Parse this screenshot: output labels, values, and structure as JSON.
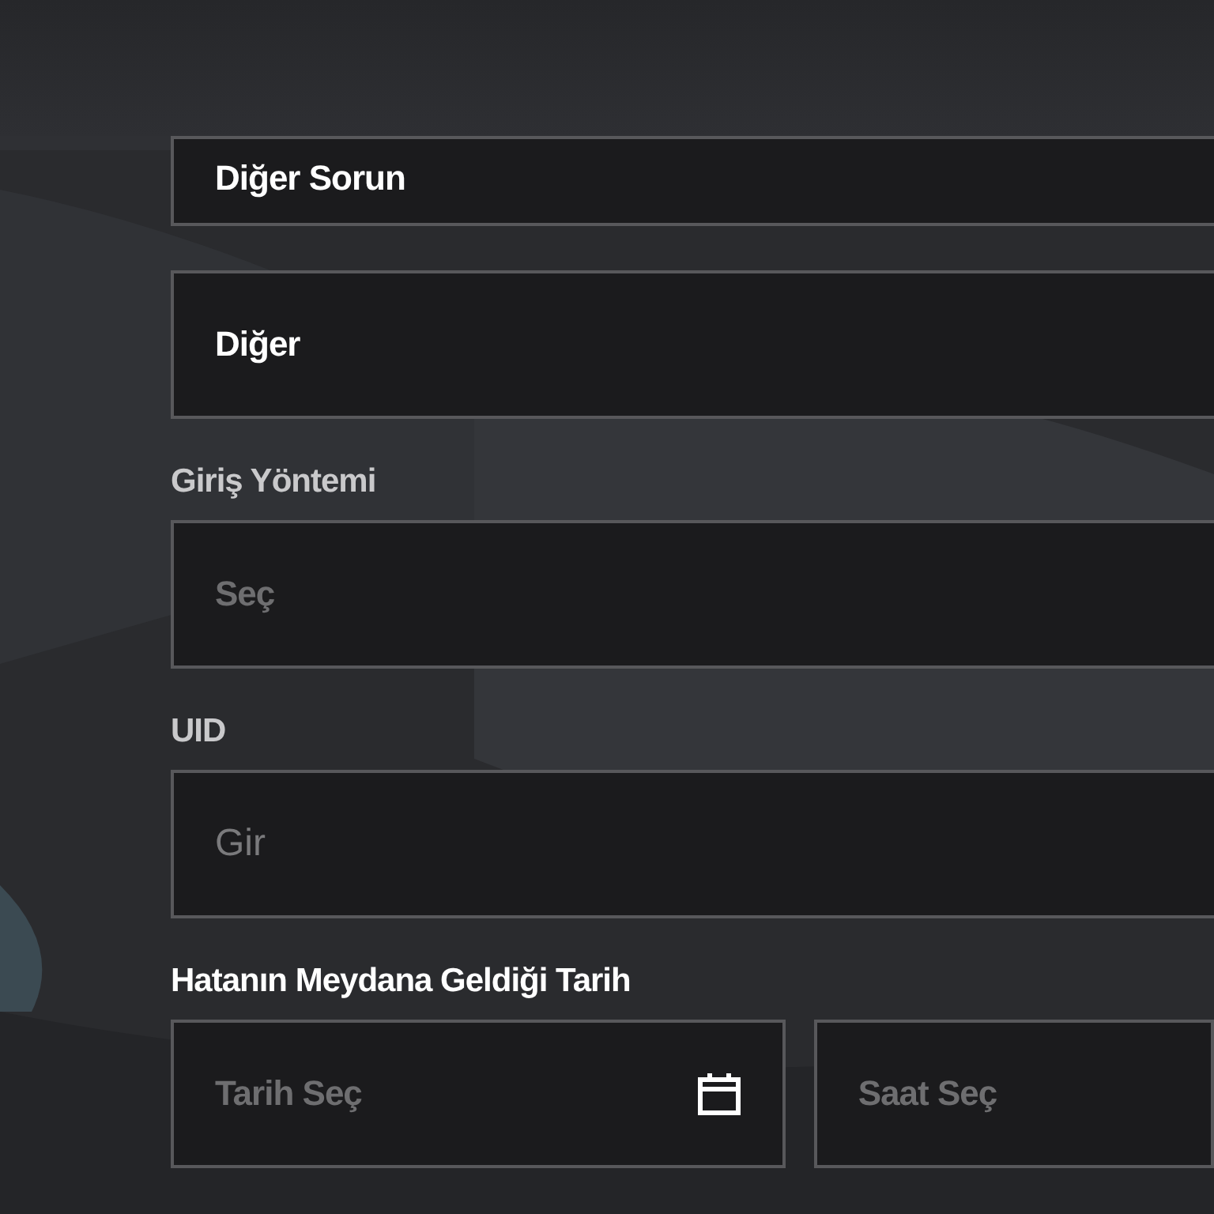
{
  "fields": [
    {
      "kind": "select",
      "value": "Diğer Sorun"
    },
    {
      "kind": "select",
      "value": "Diğer"
    },
    {
      "kind": "select",
      "label": "Giriş Yöntemi",
      "placeholder": "Seç"
    },
    {
      "kind": "input",
      "label": "UID",
      "placeholder": "Gir"
    },
    {
      "kind": "datetime",
      "label": "Hatanın Meydana Geldiği Tarih",
      "date_placeholder": "Tarih Seç",
      "time_placeholder": "Saat Seç"
    }
  ]
}
